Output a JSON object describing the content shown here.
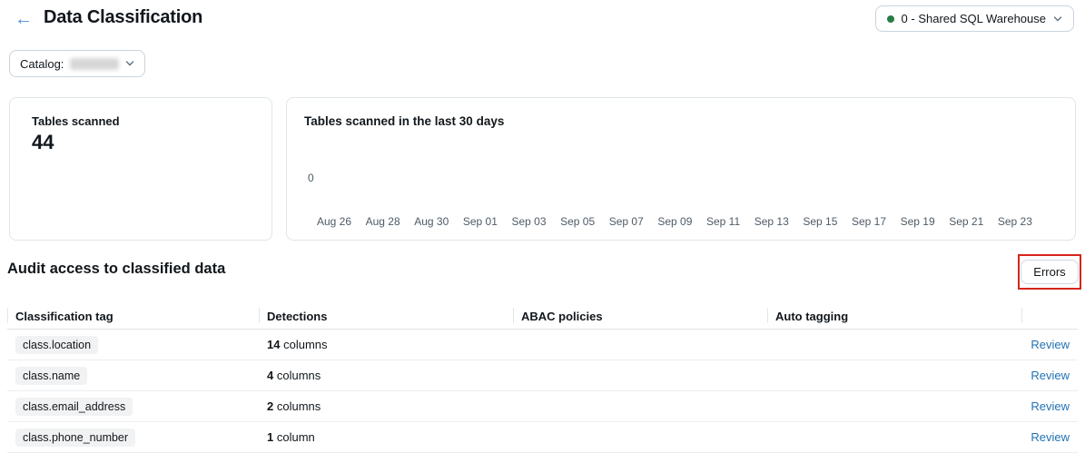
{
  "header": {
    "back_icon": "←",
    "title": "Data Classification",
    "warehouse": {
      "label": "0 - Shared SQL Warehouse"
    }
  },
  "filters": {
    "catalog": {
      "label": "Catalog:"
    }
  },
  "stats": {
    "tables_scanned": {
      "title": "Tables scanned",
      "value": "44"
    }
  },
  "chart_data": {
    "type": "line",
    "title": "Tables scanned in the last 30 days",
    "x_ticks": [
      "Aug 26",
      "Aug 28",
      "Aug 30",
      "Sep 01",
      "Sep 03",
      "Sep 05",
      "Sep 07",
      "Sep 09",
      "Sep 11",
      "Sep 13",
      "Sep 15",
      "Sep 17",
      "Sep 19",
      "Sep 21",
      "Sep 23"
    ],
    "y_ticks": [
      "0"
    ],
    "series": [],
    "xlabel": "",
    "ylabel": "",
    "grid": false,
    "legend": false
  },
  "audit": {
    "heading": "Audit access to classified data",
    "errors_button_label": "Errors",
    "table": {
      "columns": [
        "Classification tag",
        "Detections",
        "ABAC policies",
        "Auto tagging"
      ],
      "rows": [
        {
          "tag": "class.location",
          "detections_count": "14",
          "detections_unit": "columns",
          "abac_policies": "",
          "auto_tagging": "",
          "action": "Review"
        },
        {
          "tag": "class.name",
          "detections_count": "4",
          "detections_unit": "columns",
          "abac_policies": "",
          "auto_tagging": "",
          "action": "Review"
        },
        {
          "tag": "class.email_address",
          "detections_count": "2",
          "detections_unit": "columns",
          "abac_policies": "",
          "auto_tagging": "",
          "action": "Review"
        },
        {
          "tag": "class.phone_number",
          "detections_count": "1",
          "detections_unit": "column",
          "abac_policies": "",
          "auto_tagging": "",
          "action": "Review"
        }
      ]
    }
  },
  "colors": {
    "accent_blue": "#2272b4",
    "status_green": "#277c43",
    "annotation_red": "#d7251c"
  }
}
